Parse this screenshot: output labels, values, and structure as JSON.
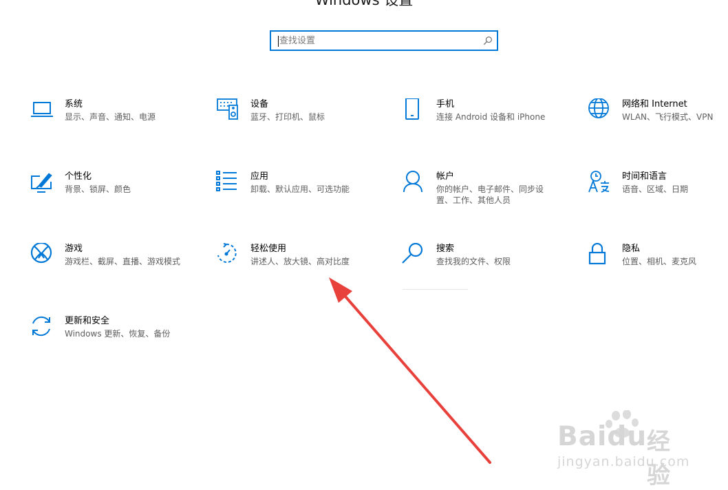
{
  "window": {
    "title": "Windows 设置"
  },
  "search": {
    "placeholder": "查找设置",
    "value": ""
  },
  "colors": {
    "accent": "#0078d7",
    "annotation_arrow": "#e8403a"
  },
  "tiles": [
    {
      "icon": "laptop-icon",
      "title": "系统",
      "desc": "显示、声音、通知、电源"
    },
    {
      "icon": "keyboard-speaker-icon",
      "title": "设备",
      "desc": "蓝牙、打印机、鼠标"
    },
    {
      "icon": "phone-icon",
      "title": "手机",
      "desc": "连接 Android 设备和 iPhone"
    },
    {
      "icon": "globe-icon",
      "title": "网络和 Internet",
      "desc": "WLAN、飞行模式、VPN"
    },
    {
      "icon": "paint-brush-monitor-icon",
      "title": "个性化",
      "desc": "背景、锁屏、颜色"
    },
    {
      "icon": "apps-list-icon",
      "title": "应用",
      "desc": "卸载、默认应用、可选功能"
    },
    {
      "icon": "person-icon",
      "title": "帐户",
      "desc": "你的帐户、电子邮件、同步设置、工作、其他人员"
    },
    {
      "icon": "clock-language-icon",
      "title": "时间和语言",
      "desc": "语音、区域、日期"
    },
    {
      "icon": "xbox-icon",
      "title": "游戏",
      "desc": "游戏栏、截屏、直播、游戏模式"
    },
    {
      "icon": "ease-of-access-icon",
      "title": "轻松使用",
      "desc": "讲述人、放大镜、高对比度"
    },
    {
      "icon": "search-magnifier-icon",
      "title": "搜索",
      "desc": "查找我的文件、权限"
    },
    {
      "icon": "lock-icon",
      "title": "隐私",
      "desc": "位置、相机、麦克风"
    },
    {
      "icon": "sync-icon",
      "title": "更新和安全",
      "desc": "Windows 更新、恢复、备份"
    }
  ],
  "watermark": {
    "brand": "Baidu",
    "brand_suffix": "经验",
    "domain": "jingyan.baidu.com"
  }
}
